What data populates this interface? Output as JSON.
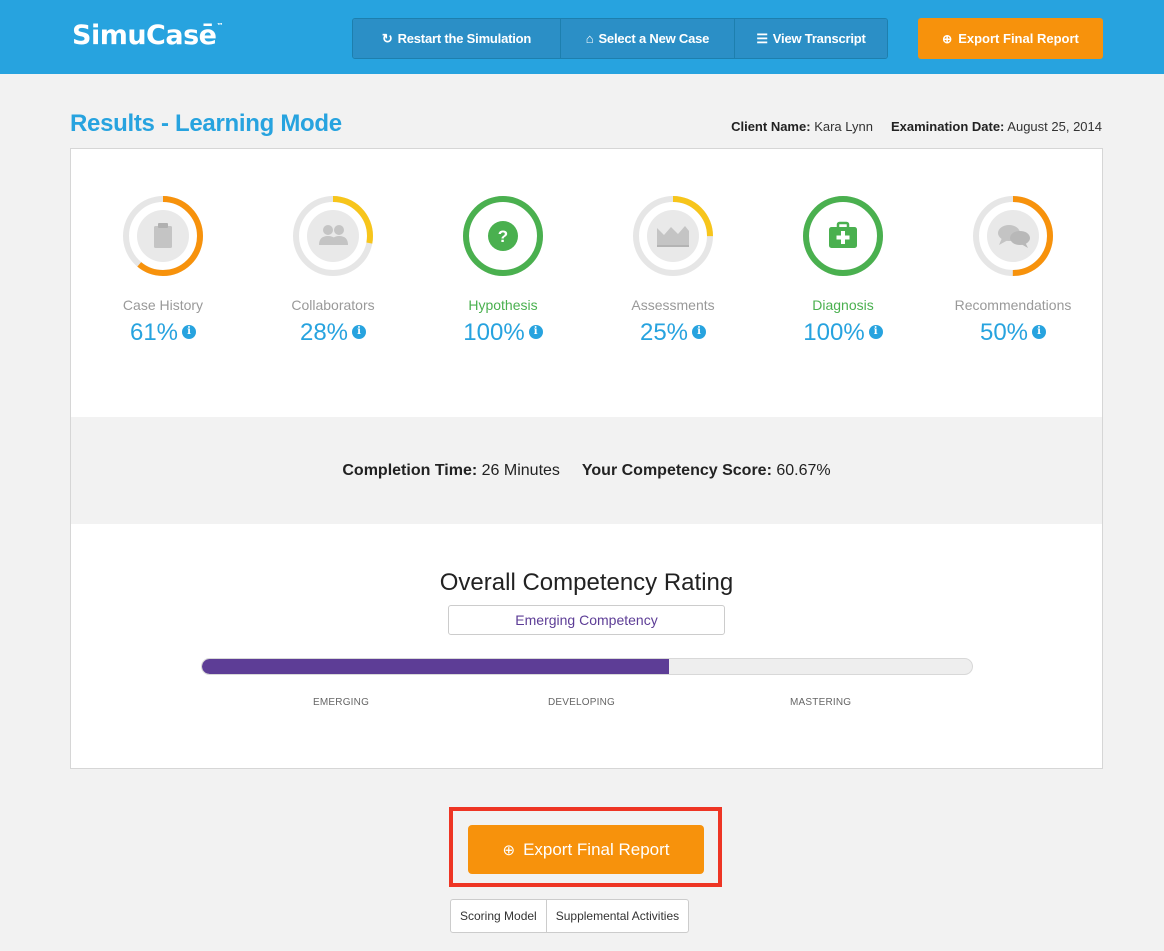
{
  "header": {
    "logo": "SimuCasē",
    "logo_tm": "™",
    "nav": [
      {
        "icon": "refresh-icon",
        "glyph": "↻",
        "label": "Restart the Simulation"
      },
      {
        "icon": "home-icon",
        "glyph": "⌂",
        "label": "Select a New Case"
      },
      {
        "icon": "list-icon",
        "glyph": "☰",
        "label": "View Transcript"
      }
    ],
    "export": {
      "icon": "download-circle-icon",
      "glyph": "⊕",
      "label": "Export Final Report"
    }
  },
  "results": {
    "title": "Results - Learning Mode",
    "client_label": "Client Name:",
    "client_value": "Kara Lynn",
    "date_label": "Examination Date:",
    "date_value": "August 25, 2014"
  },
  "metrics": [
    {
      "label": "Case History",
      "value": "61%",
      "fraction": 0.61,
      "color": "#f7920c",
      "icon": "clipboard-icon",
      "status": "normal"
    },
    {
      "label": "Collaborators",
      "value": "28%",
      "fraction": 0.28,
      "color": "#f7c51b",
      "icon": "people-icon",
      "status": "normal"
    },
    {
      "label": "Hypothesis",
      "value": "100%",
      "fraction": 1.0,
      "color": "#4ab04f",
      "icon": "question-icon",
      "status": "complete"
    },
    {
      "label": "Assessments",
      "value": "25%",
      "fraction": 0.25,
      "color": "#f7c51b",
      "icon": "chart-icon",
      "status": "normal"
    },
    {
      "label": "Diagnosis",
      "value": "100%",
      "fraction": 1.0,
      "color": "#4ab04f",
      "icon": "medkit-icon",
      "status": "complete"
    },
    {
      "label": "Recommendations",
      "value": "50%",
      "fraction": 0.5,
      "color": "#f7920c",
      "icon": "chat-icon",
      "status": "normal"
    }
  ],
  "info_glyph": "i",
  "stats": {
    "completion_label": "Completion Time:",
    "completion_value": "26 Minutes",
    "score_label": "Your Competency Score:",
    "score_value": "60.67%"
  },
  "rating": {
    "title": "Overall Competency Rating",
    "level": "Emerging Competency",
    "progress": 0.6067,
    "scale": [
      "EMERGING",
      "DEVELOPING",
      "MASTERING"
    ]
  },
  "footer": {
    "export": {
      "icon": "download-circle-icon",
      "glyph": "⊕",
      "label": "Export Final Report"
    },
    "links": [
      "Scoring Model",
      "Supplemental Activities"
    ]
  },
  "colors": {
    "brand": "#27a3df",
    "accent": "#f7920c",
    "success": "#4ab04f",
    "purple": "#5d3d96",
    "highlight": "#ee3524"
  }
}
